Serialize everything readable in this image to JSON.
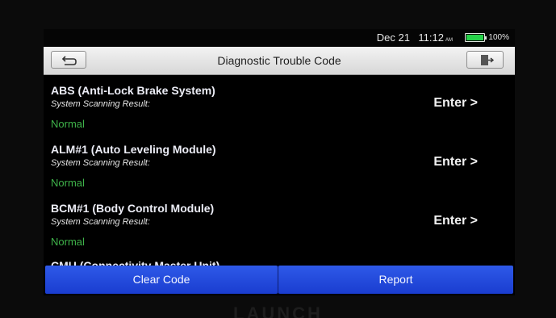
{
  "status_bar": {
    "date": "Dec 21",
    "time": "11:12",
    "ampm": "AM",
    "battery_percent": "100%",
    "battery_level": 1.0,
    "battery_color": "#27d24a"
  },
  "title_bar": {
    "title": "Diagnostic Trouble Code",
    "back_icon": "back-arrow-icon",
    "exit_icon": "exit-door-icon"
  },
  "systems": [
    {
      "name": "ABS (Anti-Lock Brake System)",
      "sub_label": "System Scanning Result:",
      "result": "Normal",
      "enter_label": "Enter >"
    },
    {
      "name": "ALM#1 (Auto Leveling Module)",
      "sub_label": "System Scanning Result:",
      "result": "Normal",
      "enter_label": "Enter >"
    },
    {
      "name": "BCM#1 (Body Control Module)",
      "sub_label": "System Scanning Result:",
      "result": "Normal",
      "enter_label": "Enter >"
    },
    {
      "name": "CMU (Connectivity Master Unit)"
    }
  ],
  "actions": {
    "clear_code": "Clear Code",
    "report": "Report",
    "accent_color": "#2447dd"
  },
  "bezel": {
    "logo": "LAUNCH"
  },
  "colors": {
    "normal_status": "#3fb34a"
  }
}
